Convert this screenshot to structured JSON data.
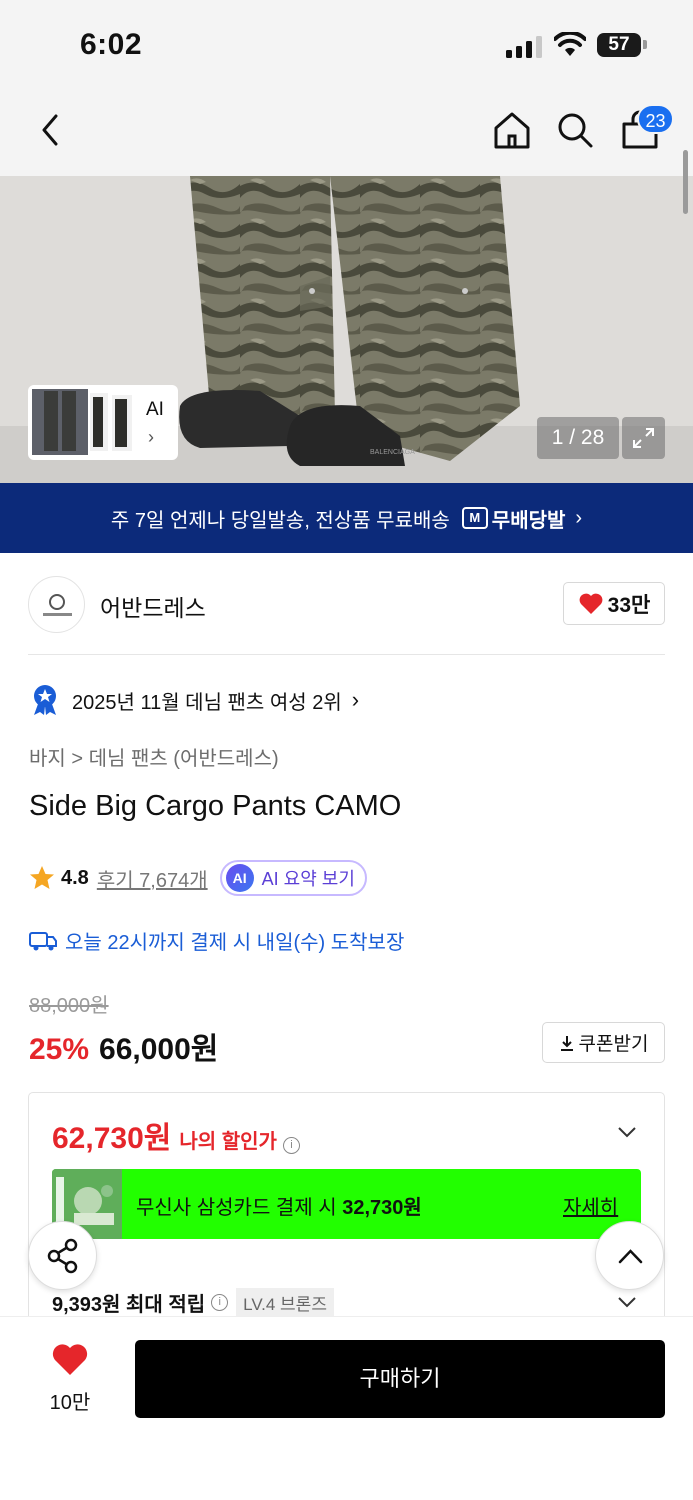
{
  "status_bar": {
    "time": "6:02",
    "battery": "57"
  },
  "nav": {
    "cart_count": "23"
  },
  "gallery": {
    "counter": "1 / 28",
    "ai_label": "AI",
    "ai_chevron": "›"
  },
  "banner": {
    "text": "주 7일 언제나 당일발송, 전상품 무료배송",
    "badge_icon_text": "M",
    "badge_label": "무배당발",
    "arrow": "›"
  },
  "brand": {
    "name": "어반드레스",
    "likes": "33만"
  },
  "ranking": {
    "text": "2025년 11월 데님 팬츠 여성 2위",
    "arrow": "›"
  },
  "breadcrumb": "바지  >  데님 팬츠 (어반드레스)",
  "product": {
    "title": "Side Big Cargo Pants CAMO"
  },
  "rating": {
    "score": "4.8",
    "reviews": "후기 7,674개",
    "ai_badge": "AI",
    "ai_summary": "AI 요약 보기"
  },
  "delivery": {
    "text": "오늘 22시까지 결제 시 내일(수) 도착보장"
  },
  "price": {
    "original": "88,000원",
    "discount_pct": "25%",
    "sale": "66,000원",
    "coupon_label": "쿠폰받기"
  },
  "my_discount": {
    "amount": "62,730원",
    "label": "나의 할인가",
    "info": "i"
  },
  "card_promo": {
    "text_prefix": "무신사 삼성카드 결제 시",
    "text_amount": "32,730원",
    "detail": "자세히"
  },
  "points": {
    "text": "9,393원 최대 적립",
    "info": "i",
    "level": "LV.4 브론즈"
  },
  "bottom": {
    "wish_count": "10만",
    "buy_label": "구매하기"
  },
  "colors": {
    "accent_red": "#e5262b",
    "banner_navy": "#0c2a7a",
    "promo_green": "#22ff00",
    "link_blue": "#1a5dd6",
    "badge_blue": "#1a6ff0"
  }
}
